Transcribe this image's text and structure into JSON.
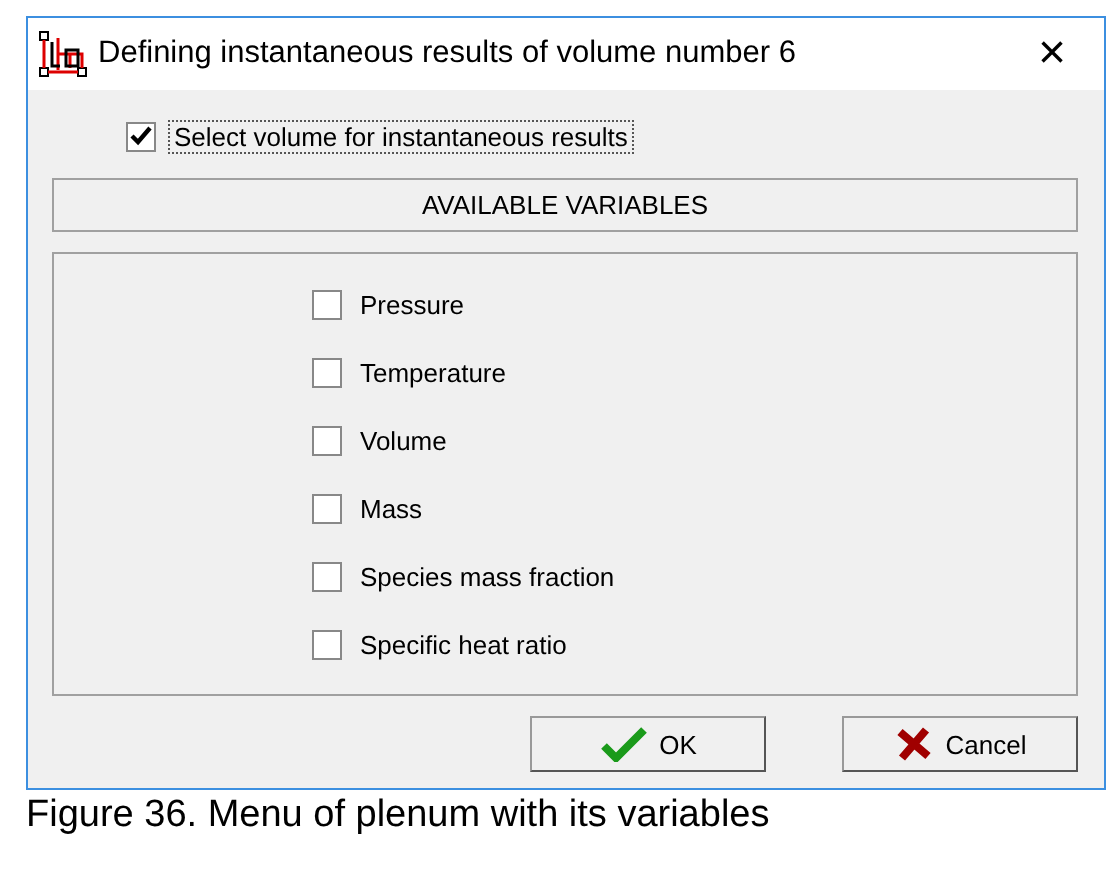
{
  "window": {
    "title": "Defining instantaneous results of volume number 6",
    "close": "×"
  },
  "select_volume": {
    "label": "Select volume for instantaneous results",
    "checked": true
  },
  "header": "AVAILABLE VARIABLES",
  "variables": [
    {
      "label": "Pressure",
      "checked": false
    },
    {
      "label": "Temperature",
      "checked": false
    },
    {
      "label": "Volume",
      "checked": false
    },
    {
      "label": "Mass",
      "checked": false
    },
    {
      "label": "Species mass fraction",
      "checked": false
    },
    {
      "label": "Specific heat ratio",
      "checked": false
    }
  ],
  "buttons": [
    {
      "kind": "ok",
      "label": "OK"
    },
    {
      "kind": "cancel",
      "label": "Cancel"
    }
  ],
  "caption": "Figure 36. Menu of plenum with its variables"
}
